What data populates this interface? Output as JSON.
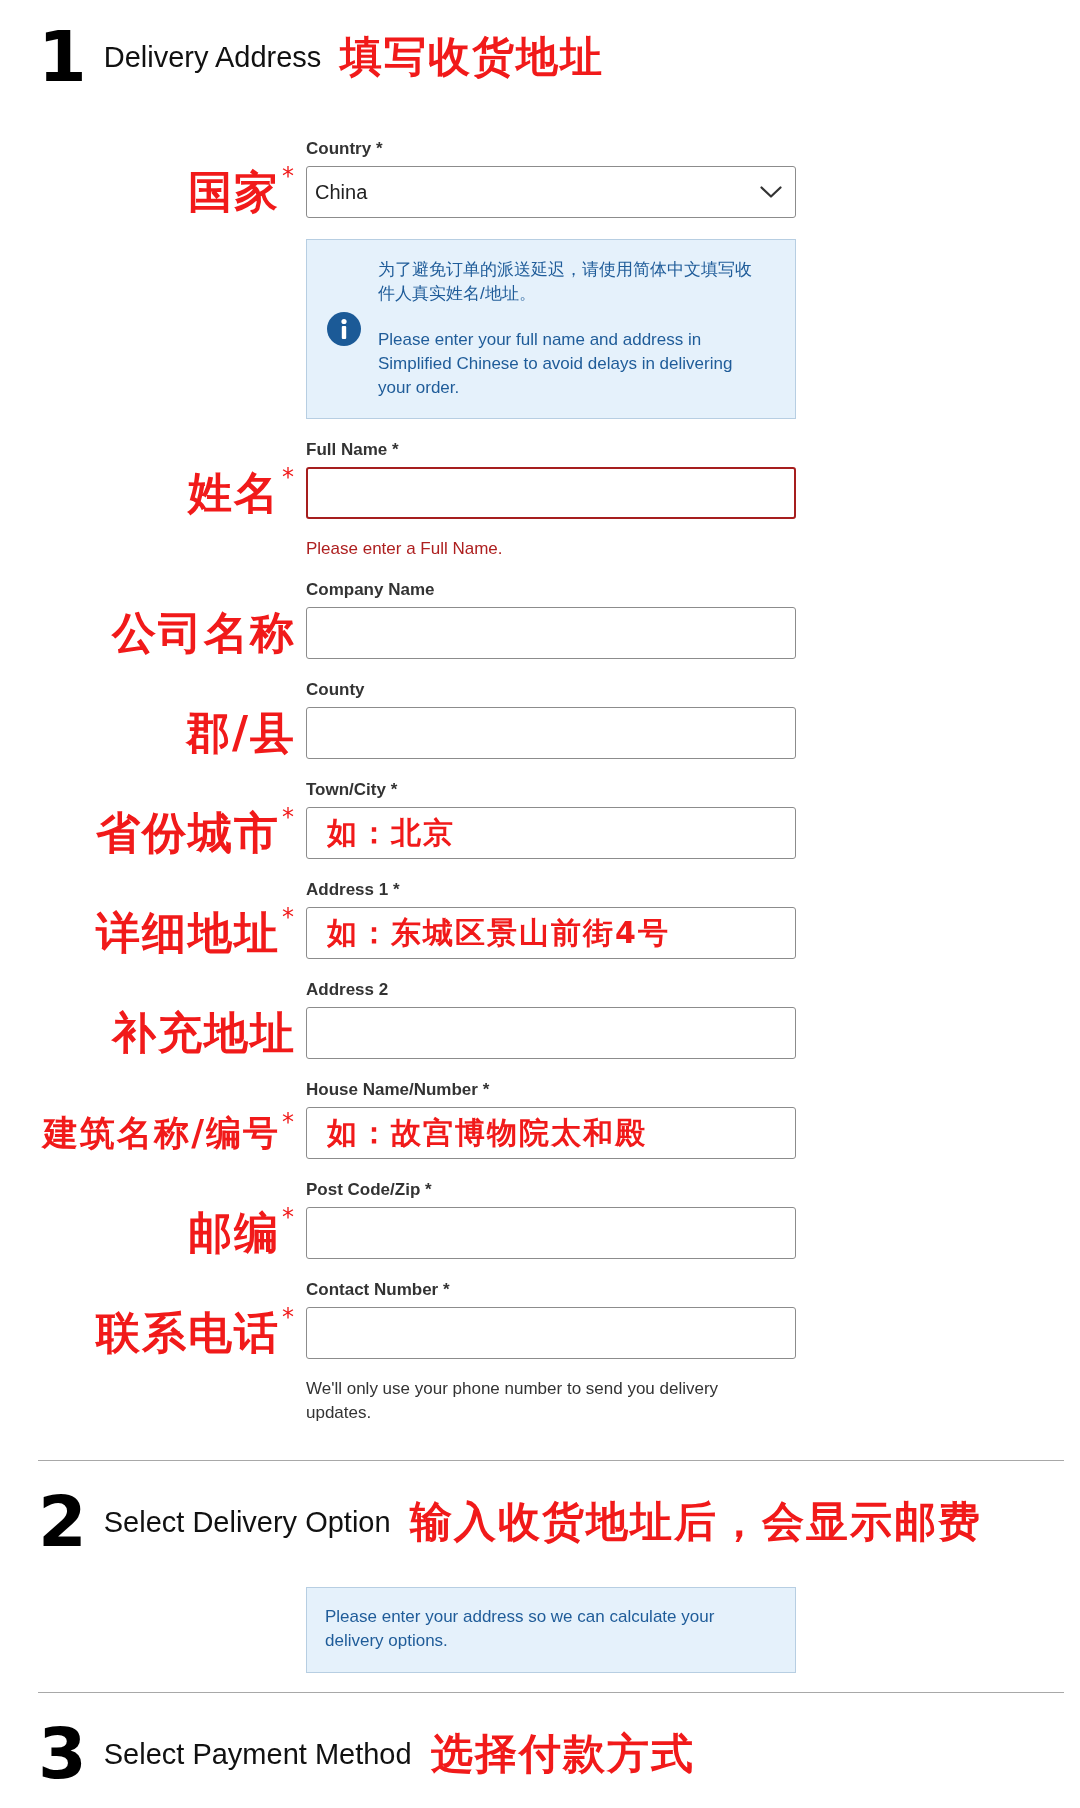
{
  "sections": [
    {
      "number": "1",
      "title": "Delivery Address",
      "annotation": "填写收货地址",
      "items": [
        {
          "kind": "select",
          "label": "Country *",
          "annotation": "国家$^{*}$",
          "value": "China",
          "invalid": false
        },
        {
          "kind": "notice",
          "info_icon": true,
          "paragraphs": [
            "为了避免订单的派送延迟，请使用简体中文填写收件人真实姓名/地址。",
            "Please enter your full name and address in Simplified Chinese to avoid delays in delivering your order."
          ]
        },
        {
          "kind": "text",
          "label": "Full Name *",
          "annotation": "姓名$^{*}$",
          "invalid": true,
          "error": "Please enter a Full Name."
        },
        {
          "kind": "text",
          "label": "Company Name",
          "annotation": "公司名称",
          "invalid": false
        },
        {
          "kind": "text",
          "label": "County",
          "annotation": "郡/县",
          "invalid": false
        },
        {
          "kind": "text",
          "label": "Town/City *",
          "annotation": "省份城市$^{*}$",
          "invalid": false,
          "example": "如：北京"
        },
        {
          "kind": "text",
          "label": "Address 1 *",
          "annotation": "详细地址$^{*}$",
          "invalid": false,
          "example": "如：东城区景山前街4号"
        },
        {
          "kind": "text",
          "label": "Address 2",
          "annotation": "补充地址",
          "invalid": false
        },
        {
          "kind": "text",
          "label": "House Name/Number *",
          "annotation": "建筑名称/编号$^{*}$",
          "invalid": false,
          "example": "如：故宫博物院太和殿"
        },
        {
          "kind": "text",
          "label": "Post Code/Zip *",
          "annotation": "邮编$^{*}$",
          "invalid": false
        },
        {
          "kind": "text",
          "label": "Contact Number *",
          "annotation": "联系电话$^{*}$",
          "invalid": false,
          "hint": "We'll only use your phone number to send you delivery updates."
        }
      ]
    },
    {
      "number": "2",
      "title": "Select Delivery Option",
      "annotation": "输入收货地址后，会显示邮费",
      "items": [
        {
          "kind": "notice",
          "info_icon": false,
          "paragraphs": [
            "Please enter your address so we can calculate your delivery options."
          ]
        }
      ]
    },
    {
      "number": "3",
      "title": "Select Payment Method",
      "annotation": "选择付款方式"
    }
  ]
}
